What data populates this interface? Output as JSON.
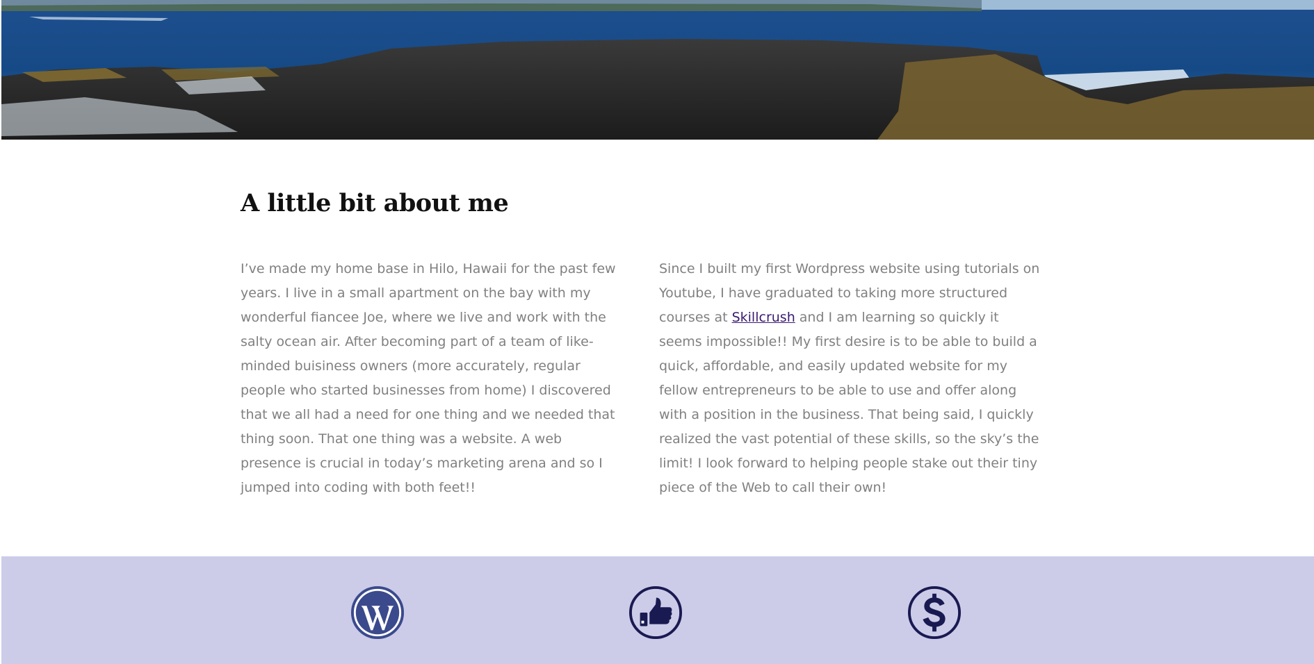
{
  "hero": {
    "image": "coastal-lava-rock-ocean-photo"
  },
  "about": {
    "heading": "A little bit about me",
    "col1": "I’ve made my home base in Hilo, Hawaii for the past few years. I live in a small apartment on the bay with my wonderful fiancee Joe, where we live and work with the salty ocean air. After becoming part of a team of like-minded buisiness owners (more accurately, regular people who started businesses from home) I discovered that we all had a need for one thing and we needed that thing soon. That one thing was a website. A web presence is crucial in today’s marketing arena and so I jumped into coding with both feet!!",
    "col2_before": "Since I built my first Wordpress website using tutorials on Youtube, I have graduated to taking more structured courses at ",
    "col2_link": "Skillcrush",
    "col2_after": " and I am learning so quickly it seems impossible!! My first desire is to be able to build a quick, affordable, and easily updated website for my fellow entrepreneurs to be able to use and offer along with a position in the business. That being said, I quickly realized the vast potential of these skills, so the sky’s the limit! I look forward to helping people stake out their tiny piece of the Web to call their own!"
  },
  "band": {
    "background": "#cccce9",
    "icons": [
      "wordpress-icon",
      "thumbs-up-icon",
      "dollar-icon"
    ],
    "icon_color": "#1a1a52"
  }
}
